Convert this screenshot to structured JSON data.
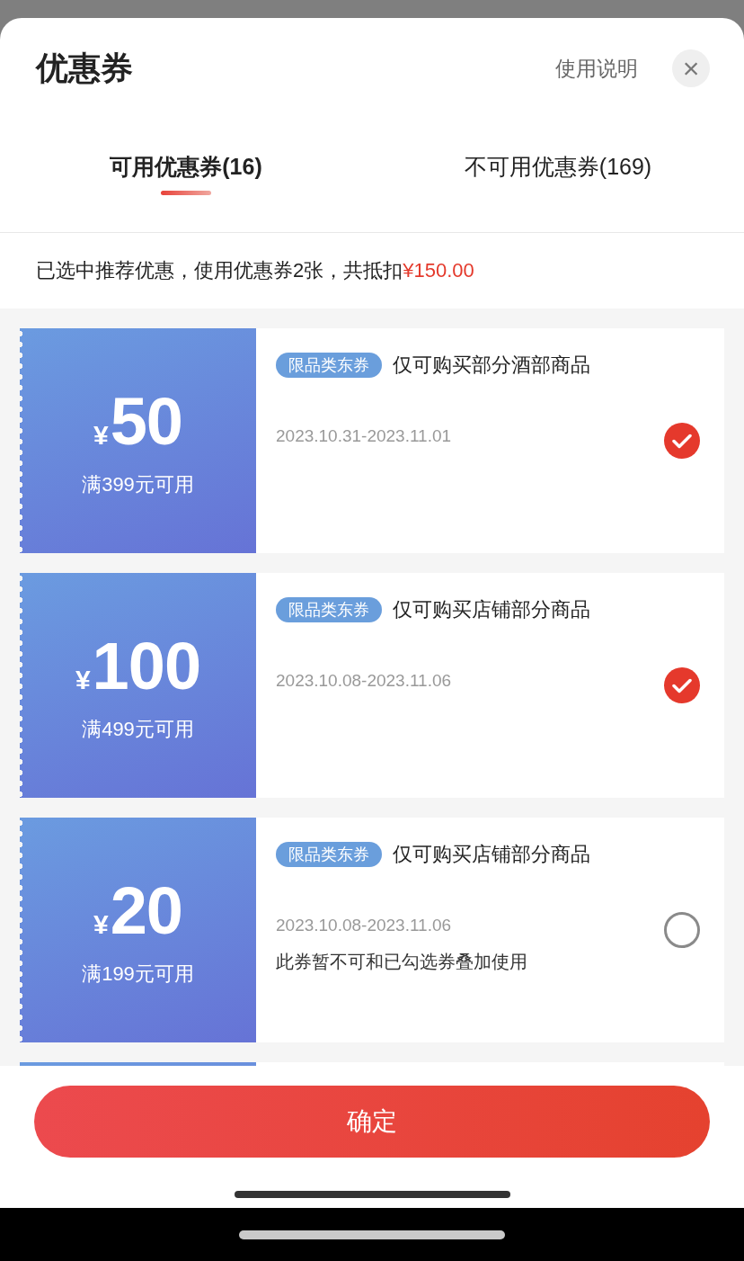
{
  "header": {
    "title": "优惠券",
    "help_link": "使用说明",
    "close_icon": "×"
  },
  "tabs": [
    {
      "label": "可用优惠券(16)",
      "selected": true
    },
    {
      "label": "不可用优惠券(169)",
      "selected": false
    }
  ],
  "summary": {
    "text": "已选中推荐优惠，使用优惠券2张，共抵扣",
    "amount": "¥150.00"
  },
  "coupons": [
    {
      "currency": "¥",
      "amount": "50",
      "condition": "满399元可用",
      "tag": "限品类东券",
      "title": "仅可购买部分酒部商品",
      "validity": "2023.10.31-2023.11.01",
      "checked": true
    },
    {
      "currency": "¥",
      "amount": "100",
      "condition": "满499元可用",
      "tag": "限品类东券",
      "title": "仅可购买店铺部分商品",
      "validity": "2023.10.08-2023.11.06",
      "checked": true
    },
    {
      "currency": "¥",
      "amount": "20",
      "condition": "满199元可用",
      "tag": "限品类东券",
      "title": "仅可购买店铺部分商品",
      "validity": "2023.10.08-2023.11.06",
      "note": "此券暂不可和已勾选券叠加使用",
      "checked": false
    }
  ],
  "more_coupons_below": true,
  "confirm_button": "确定"
}
